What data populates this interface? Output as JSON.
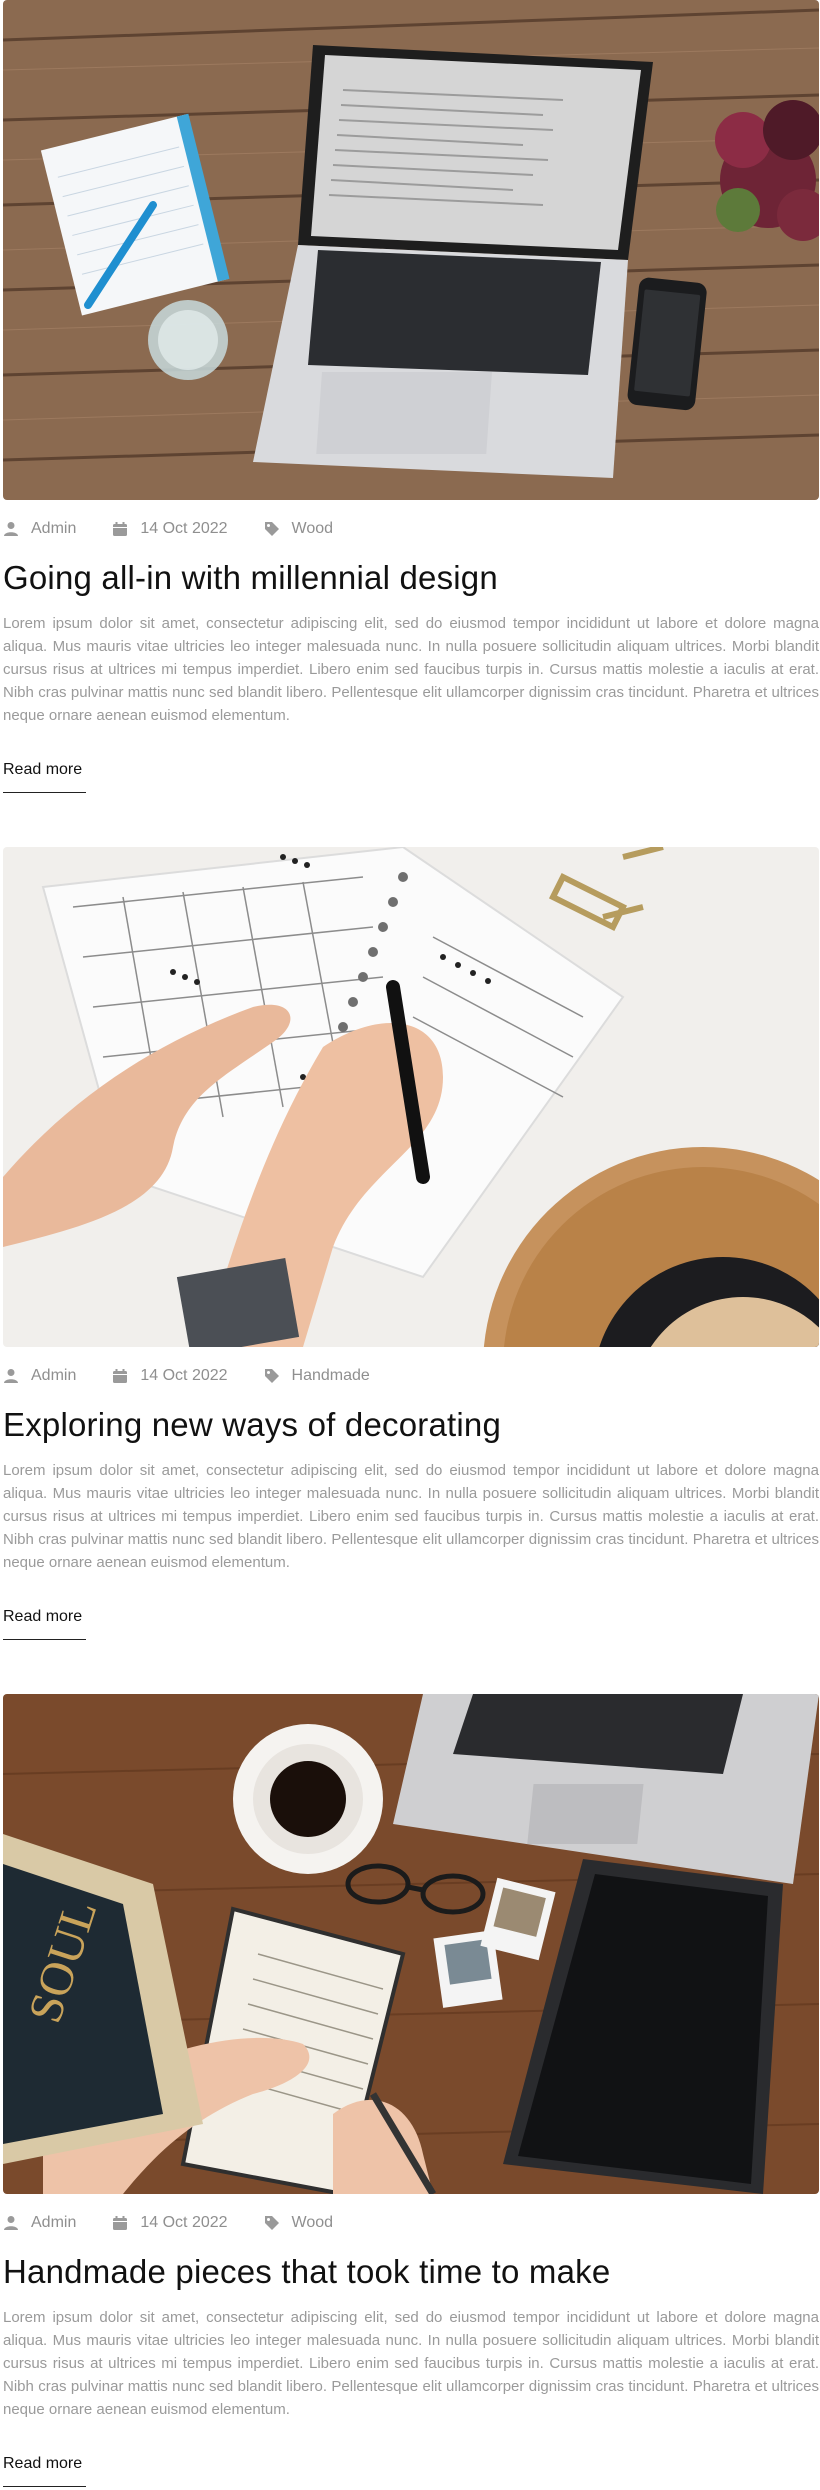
{
  "posts": [
    {
      "image_icon": "laptop-desk-photo",
      "author": "Admin",
      "date": "14 Oct 2022",
      "category": "Wood",
      "title": "Going all-in with millennial design",
      "excerpt": "Lorem ipsum dolor sit amet, consectetur adipiscing elit, sed do eiusmod tempor incididunt ut labore et dolore magna aliqua. Mus mauris vitae ultricies leo integer malesuada nunc. In nulla posuere sollicitudin aliquam ultrices. Morbi blandit cursus risus at ultrices mi tempus imperdiet. Libero enim sed faucibus turpis in. Cursus mattis molestie a iaculis at erat. Nibh cras pulvinar mattis nunc sed blandit libero. Pellentesque elit ullamcorper dignissim cras tincidunt. Pharetra et ultrices neque ornare aenean euismod elementum.",
      "read_more": "Read more"
    },
    {
      "image_icon": "planner-hands-photo",
      "author": "Admin",
      "date": "14 Oct 2022",
      "category": "Handmade",
      "title": "Exploring new ways of decorating",
      "excerpt": "Lorem ipsum dolor sit amet, consectetur adipiscing elit, sed do eiusmod tempor incididunt ut labore et dolore magna aliqua. Mus mauris vitae ultricies leo integer malesuada nunc. In nulla posuere sollicitudin aliquam ultrices. Morbi blandit cursus risus at ultrices mi tempus imperdiet. Libero enim sed faucibus turpis in. Cursus mattis molestie a iaculis at erat. Nibh cras pulvinar mattis nunc sed blandit libero. Pellentesque elit ullamcorper dignissim cras tincidunt. Pharetra et ultrices neque ornare aenean euismod elementum.",
      "read_more": "Read more"
    },
    {
      "image_icon": "notebook-coffee-photo",
      "author": "Admin",
      "date": "14 Oct 2022",
      "category": "Wood",
      "title": "Handmade pieces that took time to make",
      "excerpt": "Lorem ipsum dolor sit amet, consectetur adipiscing elit, sed do eiusmod tempor incididunt ut labore et dolore magna aliqua. Mus mauris vitae ultricies leo integer malesuada nunc. In nulla posuere sollicitudin aliquam ultrices. Morbi blandit cursus risus at ultrices mi tempus imperdiet. Libero enim sed faucibus turpis in. Cursus mattis molestie a iaculis at erat. Nibh cras pulvinar mattis nunc sed blandit libero. Pellentesque elit ullamcorper dignissim cras tincidunt. Pharetra et ultrices neque ornare aenean euismod elementum.",
      "read_more": "Read more"
    }
  ],
  "colors": {
    "meta_text": "#8f8f8f",
    "excerpt_text": "#9a9a9a",
    "title_text": "#111111"
  }
}
